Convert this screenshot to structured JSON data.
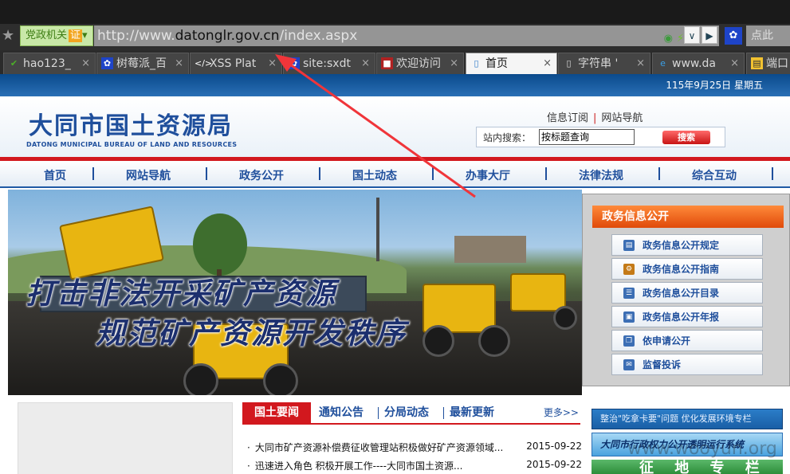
{
  "browser": {
    "security_badge": "党政机关",
    "cert_label": "证",
    "url_prefix": "http://www.",
    "url_domain": "datonglr.gov.cn",
    "url_path": "/index.aspx",
    "search_placeholder": "点此",
    "tabs": [
      {
        "label": "hao123_",
        "icon": "hao123-icon"
      },
      {
        "label": "树莓派_百",
        "icon": "paw-icon"
      },
      {
        "label": "XSS Plat",
        "icon": "code-icon"
      },
      {
        "label": "site:sxdt",
        "icon": "paw-icon"
      },
      {
        "label": "欢迎访问",
        "icon": "page-icon"
      },
      {
        "label": "首页",
        "icon": "page-icon",
        "active": true
      },
      {
        "label": "字符串 '",
        "icon": "page-icon"
      },
      {
        "label": "www.da",
        "icon": "ie-icon"
      },
      {
        "label": "端口",
        "icon": "page-icon"
      }
    ]
  },
  "site": {
    "date": "115年9月25日 星期五",
    "title_cn": "大同市国土资源局",
    "title_en": "DATONG MUNICIPAL BUREAU OF LAND AND RESOURCES",
    "top_links": [
      "信息订阅",
      "网站导航"
    ],
    "search_label": "站内搜索：",
    "search_value": "按标题查询",
    "search_button": "搜索",
    "nav": [
      "首页",
      "网站导航",
      "政务公开",
      "国土动态",
      "办事大厅",
      "法律法规",
      "综合互动"
    ]
  },
  "banner": {
    "line1": "打击非法开采矿产资源",
    "line2": "规范矿产资源开发秩序"
  },
  "gov_panel": {
    "title": "政务信息公开",
    "items": [
      "政务信息公开规定",
      "政务信息公开指南",
      "政务信息公开目录",
      "政务信息公开年报",
      "依申请公开",
      "监督投诉"
    ]
  },
  "news": {
    "tabs": [
      "国土要闻",
      "通知公告",
      "分局动态",
      "最新更新"
    ],
    "more": "更多>>",
    "items": [
      {
        "title": "大同市矿产资源补偿费征收管理站积极做好矿产资源领域...",
        "date": "2015-09-22"
      },
      {
        "title": "迅速进入角色 积极开展工作----大同市国土资源...",
        "date": "2015-09-22"
      }
    ]
  },
  "promos": {
    "promo1": "整治\"吃拿卡要\"问题 优化发展环境专栏",
    "promo2": "大同市行政权力公开透明运行系统",
    "promo3": "征 地 专 栏",
    "watermark": "www.wooyun.org"
  },
  "colors": {
    "brand_blue": "#1f4f9c",
    "accent_red": "#d2181e",
    "panel_orange": "#e04a0a",
    "annotation_arrow": "#f0353a"
  }
}
